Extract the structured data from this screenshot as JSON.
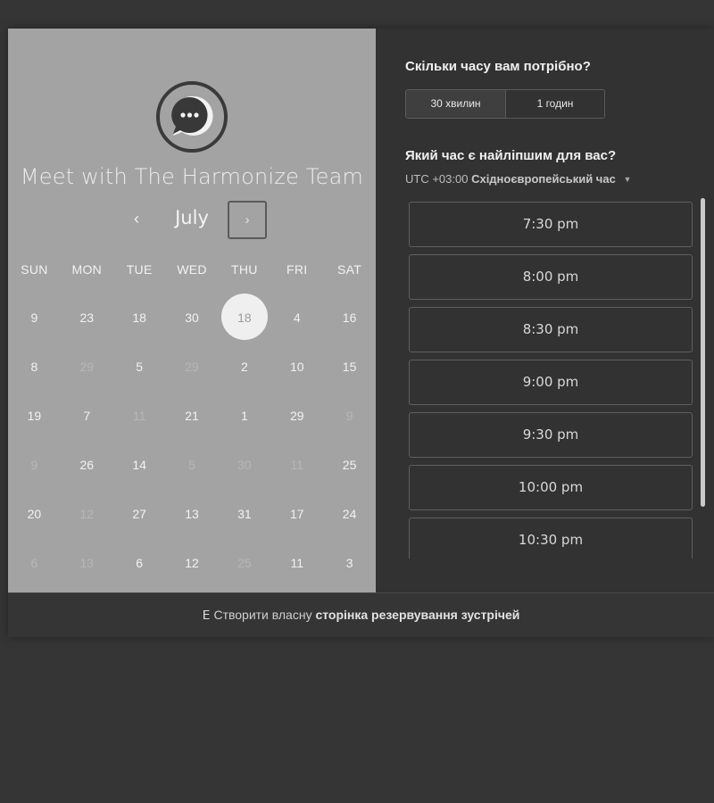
{
  "left": {
    "title": "Meet with The Harmonize Team",
    "month": "July",
    "prev_glyph": "‹",
    "next_glyph": "›",
    "days_of_week": [
      "SUN",
      "MON",
      "TUE",
      "WED",
      "THU",
      "FRI",
      "SAT"
    ],
    "weeks": [
      [
        {
          "d": "9"
        },
        {
          "d": "23"
        },
        {
          "d": "18"
        },
        {
          "d": "30"
        },
        {
          "d": "18",
          "selected": true
        },
        {
          "d": "4"
        },
        {
          "d": "16"
        }
      ],
      [
        {
          "d": "8"
        },
        {
          "d": "29",
          "dim": true
        },
        {
          "d": "5"
        },
        {
          "d": "29",
          "dim": true
        },
        {
          "d": "2"
        },
        {
          "d": "10"
        },
        {
          "d": "15"
        }
      ],
      [
        {
          "d": "19"
        },
        {
          "d": "7"
        },
        {
          "d": "11",
          "dim": true
        },
        {
          "d": "21"
        },
        {
          "d": "1"
        },
        {
          "d": "29"
        },
        {
          "d": "9",
          "dim": true
        }
      ],
      [
        {
          "d": "9",
          "dim": true
        },
        {
          "d": "26"
        },
        {
          "d": "14"
        },
        {
          "d": "5",
          "dim": true
        },
        {
          "d": "30",
          "dim": true
        },
        {
          "d": "11",
          "dim": true
        },
        {
          "d": "25"
        }
      ],
      [
        {
          "d": "20"
        },
        {
          "d": "12",
          "dim": true
        },
        {
          "d": "27"
        },
        {
          "d": "13"
        },
        {
          "d": "31"
        },
        {
          "d": "17"
        },
        {
          "d": "24"
        }
      ],
      [
        {
          "d": "6",
          "dim": true
        },
        {
          "d": "13",
          "dim": true
        },
        {
          "d": "6"
        },
        {
          "d": "12"
        },
        {
          "d": "25",
          "dim": true
        },
        {
          "d": "11"
        },
        {
          "d": "3"
        }
      ]
    ]
  },
  "right": {
    "duration_question": "Скільки часу вам потрібно?",
    "durations": [
      "30 хвилин",
      "1 годин"
    ],
    "time_question": "Який час є найліпшим для вас?",
    "timezone_prefix": "UTC +03:00",
    "timezone_name": "Східноєвропейський час",
    "timezone_caret": "▼",
    "slots": [
      "7:30 pm",
      "8:00 pm",
      "8:30 pm",
      "9:00 pm",
      "9:30 pm",
      "10:00 pm",
      "10:30 pm"
    ]
  },
  "footer": {
    "logo_glyph": "ⴹ",
    "text_plain": "Створити власну",
    "text_bold": "сторінка резервування зустрічей"
  },
  "colors": {
    "left_bg": "#a3a3a3",
    "right_bg": "#323232",
    "page_bg": "#353535"
  },
  "icons": {
    "avatar": "chat-bubble-icon",
    "prev": "chevron-left-icon",
    "next": "chevron-right-icon",
    "timezone": "caret-down-icon",
    "footer": "hubspot-sprocket-icon"
  }
}
